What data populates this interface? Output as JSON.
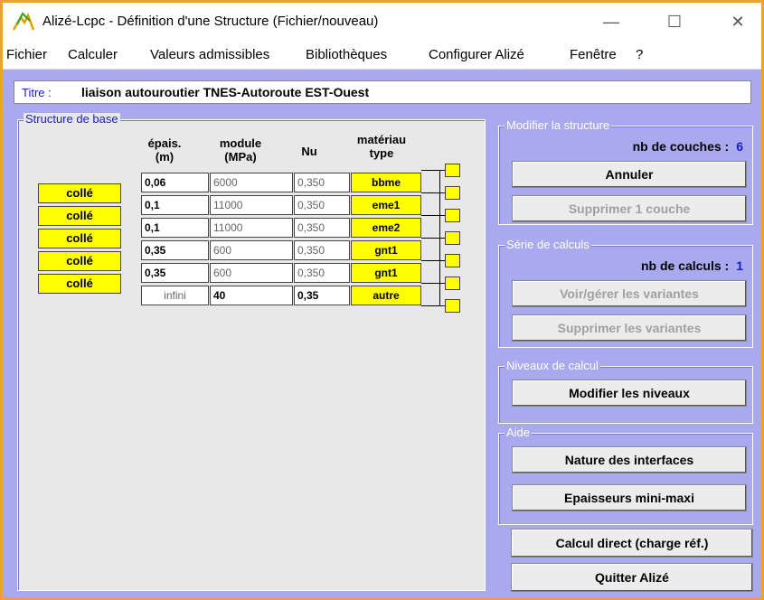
{
  "window": {
    "title": "Alizé-Lcpc - Définition d'une Structure (Fichier/nouveau)",
    "controls": {
      "minimize": "—",
      "maximize": "☐",
      "close": "✕"
    },
    "border_color": "#f0a030"
  },
  "menu": [
    "Fichier",
    "Calculer",
    "Valeurs admissibles",
    "Bibliothèques",
    "Configurer Alizé",
    "Fenêtre",
    "?"
  ],
  "titre": {
    "label": "Titre :",
    "value": "liaison autouroutier TNES-Autoroute EST-Ouest"
  },
  "structure": {
    "legend": "Structure de base",
    "headers": {
      "epais": [
        "épais.",
        "(m)"
      ],
      "module": [
        "module",
        "(MPa)"
      ],
      "nu": "Nu",
      "materiau": [
        "matériau",
        "type"
      ]
    },
    "layers": [
      {
        "epais": "0,06",
        "module": "6000",
        "nu": "0,350",
        "type": "bbme"
      },
      {
        "epais": "0,1",
        "module": "11000",
        "nu": "0,350",
        "type": "eme1"
      },
      {
        "epais": "0,1",
        "module": "11000",
        "nu": "0,350",
        "type": "eme2"
      },
      {
        "epais": "0,35",
        "module": "600",
        "nu": "0,350",
        "type": "gnt1"
      },
      {
        "epais": "0,35",
        "module": "600",
        "nu": "0,350",
        "type": "gnt1"
      },
      {
        "epais": "infini",
        "module": "40",
        "nu": "0,35",
        "type": "autre"
      }
    ],
    "interfaces": [
      "collé",
      "collé",
      "collé",
      "collé",
      "collé"
    ]
  },
  "modifier": {
    "legend": "Modifier la structure",
    "nb_label": "nb de couches :",
    "nb_value": "6",
    "annuler": "Annuler",
    "supprimer": "Supprimer 1 couche"
  },
  "serie": {
    "legend": "Série de calculs",
    "nb_label": "nb de calculs :",
    "nb_value": "1",
    "voir": "Voir/gérer les variantes",
    "supprimer": "Supprimer les variantes"
  },
  "niveaux": {
    "legend": "Niveaux de calcul",
    "modifier": "Modifier les niveaux"
  },
  "aide": {
    "legend": "Aide",
    "nature": "Nature des interfaces",
    "epaisseurs": "Epaisseurs mini-maxi"
  },
  "actions": {
    "calcul": "Calcul direct (charge réf.)",
    "quitter": "Quitter Alizé"
  },
  "colors": {
    "client_bg": "#a9a9f0",
    "accent_blue": "#1a1ac8",
    "yellow": "#ffff00"
  }
}
